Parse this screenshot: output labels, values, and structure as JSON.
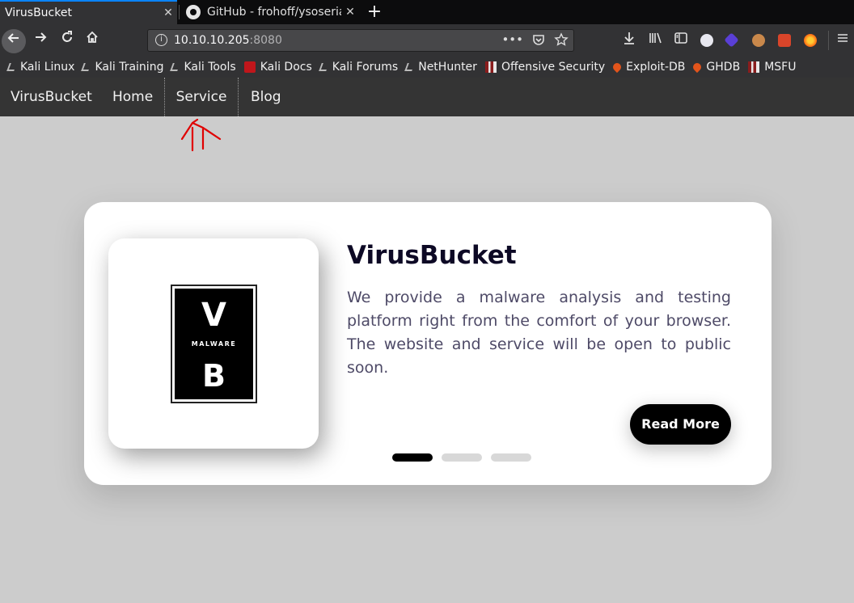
{
  "browser": {
    "tabs": [
      {
        "label": "VirusBucket",
        "active": true
      },
      {
        "label": "GitHub - frohoff/ysoseria",
        "active": false
      }
    ],
    "close_glyph": "✕",
    "new_tab_glyph": "+",
    "url_host": "10.10.10.205",
    "url_port": ":8080",
    "bookmarks": [
      {
        "label": "Kali Linux",
        "icon": "kali-dragon-icon"
      },
      {
        "label": "Kali Training",
        "icon": "kali-dragon-icon"
      },
      {
        "label": "Kali Tools",
        "icon": "kali-dragon-icon"
      },
      {
        "label": "Kali Docs",
        "icon": "kali-docs-icon"
      },
      {
        "label": "Kali Forums",
        "icon": "kali-dragon-icon"
      },
      {
        "label": "NetHunter",
        "icon": "kali-dragon-icon"
      },
      {
        "label": "Offensive Security",
        "icon": "offsec-icon"
      },
      {
        "label": "Exploit-DB",
        "icon": "exploitdb-icon"
      },
      {
        "label": "GHDB",
        "icon": "exploitdb-icon"
      },
      {
        "label": "MSFU",
        "icon": "offsec-icon"
      }
    ]
  },
  "site": {
    "nav": {
      "brand": "VirusBucket",
      "home": "Home",
      "service": "Service",
      "blog": "Blog"
    },
    "card": {
      "logo_top": "V",
      "logo_middle": "MALWARE",
      "logo_bottom": "B",
      "title": "VirusBucket",
      "text": "We provide a malware analysis and testing platform right from the comfort of your browser. The website and service will be open to public soon.",
      "button": "Read More",
      "slides": 3,
      "active_slide": 1
    }
  },
  "colors": {
    "page_bg": "#cccccc",
    "navbar_bg": "#343434",
    "annotation": "#e00000",
    "accent": "#0a84ff"
  }
}
